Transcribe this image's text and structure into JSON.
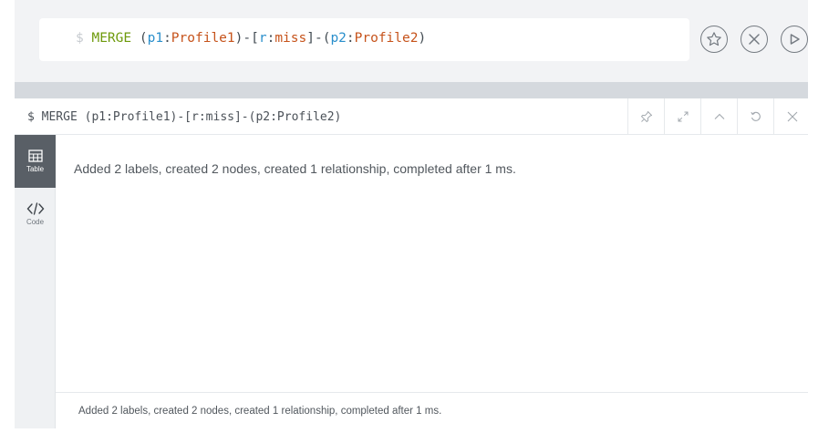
{
  "editor": {
    "prompt": "$",
    "query": {
      "kw": "MERGE",
      "p1_open": " (",
      "p1_var": "p1",
      "p1_colon": ":",
      "p1_label": "Profile1",
      "rel_open": ")-[",
      "rel_var": "r",
      "rel_colon": ":",
      "rel_label": "miss",
      "rel_close": "]-(",
      "p2_var": "p2",
      "p2_colon": ":",
      "p2_label": "Profile2",
      "end": ")"
    },
    "actions": [
      "star-icon",
      "close-circle-icon",
      "play-icon"
    ]
  },
  "frame": {
    "title": "$ MERGE (p1:Profile1)-[r:miss]-(p2:Profile2)",
    "tools": [
      "pin-icon",
      "expand-icon",
      "collapse-up-icon",
      "rerun-icon",
      "close-icon"
    ],
    "sidebar": {
      "table_label": "Table",
      "code_label": "Code"
    },
    "result_message": "Added 2 labels, created 2 nodes, created 1 relationship, completed after 1 ms.",
    "status_message": "Added 2 labels, created 2 nodes, created 1 relationship, completed after 1 ms."
  },
  "colors": {
    "keyword": "#6e9a0c",
    "variable": "#2a8fcc",
    "label": "#c6531b",
    "active_tab": "#595f66"
  }
}
